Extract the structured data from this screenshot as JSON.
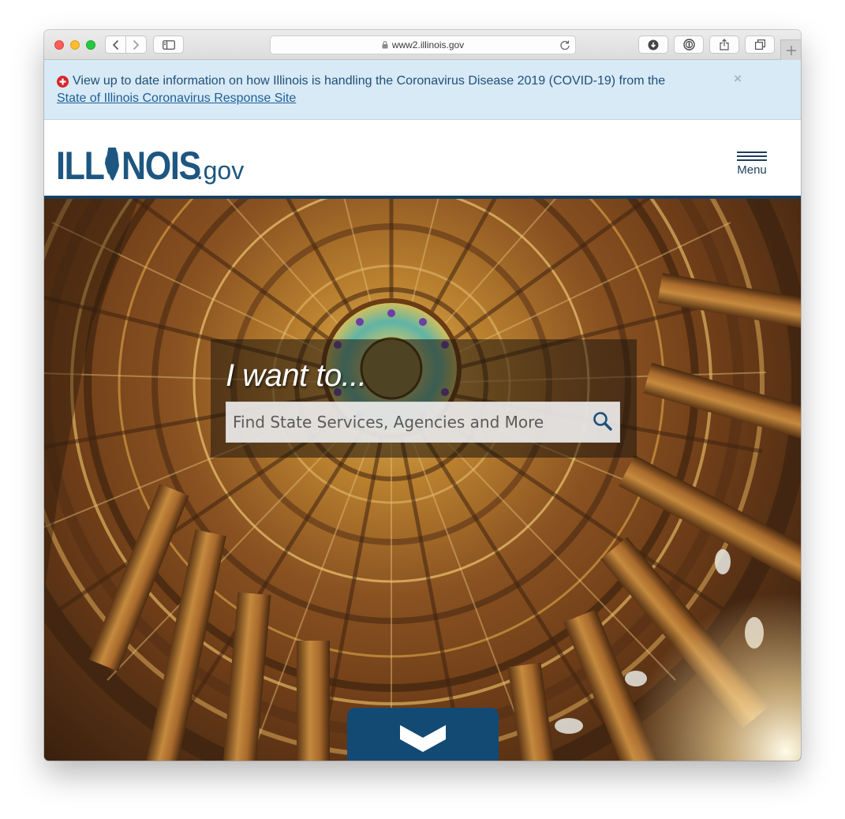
{
  "browser": {
    "url": "www2.illinois.gov"
  },
  "alert": {
    "message": "View up to date information on how Illinois is handling the Coronavirus Disease 2019 (COVID-19) from the",
    "link_text": "State of Illinois Coronavirus Response Site",
    "close_symbol": "×"
  },
  "header": {
    "logo_main_left": "ILL",
    "logo_main_right": "NOIS",
    "logo_suffix": ".gov",
    "menu_label": "Menu"
  },
  "search": {
    "heading": "I want to...",
    "placeholder": "Find State Services, Agencies and More"
  },
  "colors": {
    "brand_blue": "#1d5680",
    "header_rule": "#173f62",
    "alert_bg": "#d8eaf6",
    "scroll_button": "#134a74"
  },
  "icons": {
    "alert": "plus-circle-icon",
    "search": "magnifier-icon",
    "scroll": "chevron-down-icon"
  }
}
